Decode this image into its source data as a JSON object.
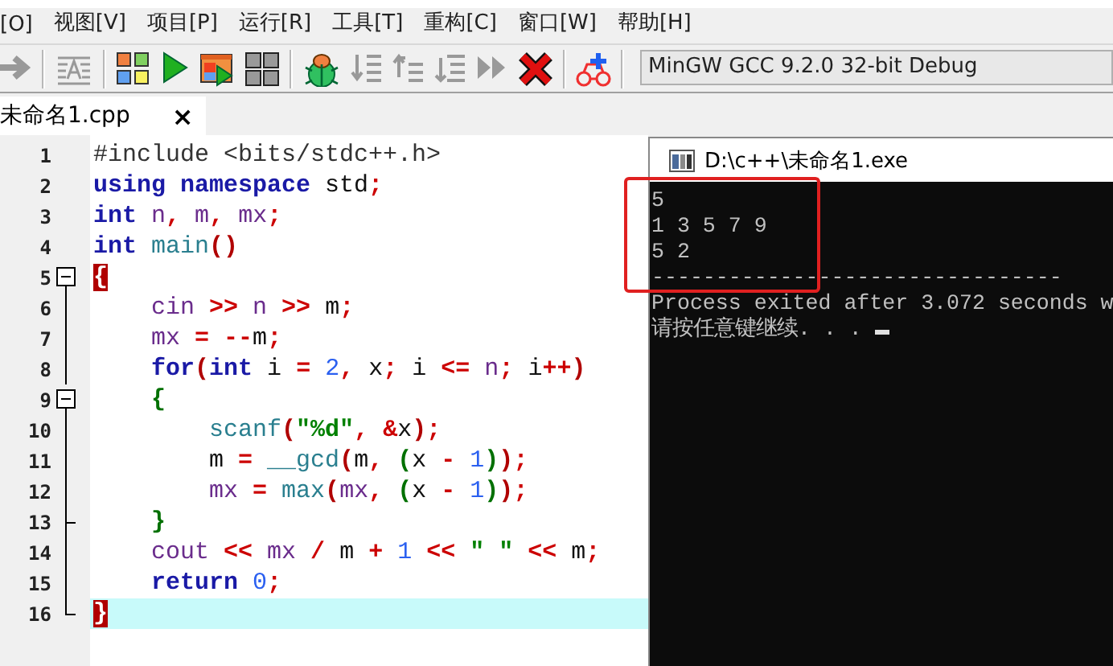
{
  "menu": [
    {
      "label": "[O]"
    },
    {
      "label": "视图[V]"
    },
    {
      "label": "项目[P]"
    },
    {
      "label": "运行[R]"
    },
    {
      "label": "工具[T]"
    },
    {
      "label": "重构[C]"
    },
    {
      "label": "窗口[W]"
    },
    {
      "label": "帮助[H]"
    }
  ],
  "toolbar": {
    "compiler": "MinGW GCC 9.2.0 32-bit Debug"
  },
  "tabs": [
    {
      "label": "未命名1.cpp",
      "close": "×",
      "selected": true
    }
  ],
  "editor": {
    "lines": [
      {
        "number": "1",
        "kind": "none",
        "current": false,
        "tokens": [
          {
            "kind": "pp",
            "t": "#include <bits/stdc++.h>"
          }
        ]
      },
      {
        "number": "2",
        "kind": "none",
        "current": false,
        "tokens": [
          {
            "kind": "kw",
            "t": "using"
          },
          {
            "kind": "kw",
            "t": " namespace"
          },
          {
            "kind": "id",
            "t": " std"
          },
          {
            "kind": "op",
            "t": ";"
          }
        ]
      },
      {
        "number": "3",
        "kind": "none",
        "current": false,
        "tokens": [
          {
            "kind": "kw",
            "t": "int"
          },
          {
            "kind": "var",
            "t": " n"
          },
          {
            "kind": "op",
            "t": ","
          },
          {
            "kind": "var",
            "t": " m"
          },
          {
            "kind": "op",
            "t": ","
          },
          {
            "kind": "var",
            "t": " mx"
          },
          {
            "kind": "op",
            "t": ";"
          }
        ]
      },
      {
        "number": "4",
        "kind": "none",
        "current": false,
        "tokens": [
          {
            "kind": "kw",
            "t": "int"
          },
          {
            "kind": "fn",
            "t": " main"
          },
          {
            "kind": "br1",
            "t": "()"
          }
        ]
      },
      {
        "number": "5",
        "kind": "start",
        "current": false,
        "tokens": [
          {
            "kind": "match",
            "t": "{"
          }
        ]
      },
      {
        "number": "6",
        "kind": "inner",
        "current": false,
        "tokens": [
          {
            "kind": "var",
            "t": "    cin"
          },
          {
            "kind": "op",
            "t": " >>"
          },
          {
            "kind": "var",
            "t": " n"
          },
          {
            "kind": "op",
            "t": " >>"
          },
          {
            "kind": "id",
            "t": " m"
          },
          {
            "kind": "op",
            "t": ";"
          }
        ]
      },
      {
        "number": "7",
        "kind": "inner",
        "current": false,
        "tokens": [
          {
            "kind": "var",
            "t": "    mx"
          },
          {
            "kind": "op",
            "t": " ="
          },
          {
            "kind": "op",
            "t": " --"
          },
          {
            "kind": "id",
            "t": "m"
          },
          {
            "kind": "op",
            "t": ";"
          }
        ]
      },
      {
        "number": "8",
        "kind": "inner",
        "current": false,
        "tokens": [
          {
            "kind": "kw",
            "t": "    for"
          },
          {
            "kind": "br1",
            "t": "("
          },
          {
            "kind": "kw",
            "t": "int"
          },
          {
            "kind": "id",
            "t": " i"
          },
          {
            "kind": "op",
            "t": " ="
          },
          {
            "kind": "num",
            "t": " 2"
          },
          {
            "kind": "op",
            "t": ","
          },
          {
            "kind": "id",
            "t": " x"
          },
          {
            "kind": "op",
            "t": ";"
          },
          {
            "kind": "id",
            "t": " i"
          },
          {
            "kind": "op",
            "t": " <="
          },
          {
            "kind": "var",
            "t": " n"
          },
          {
            "kind": "op",
            "t": ";"
          },
          {
            "kind": "id",
            "t": " i"
          },
          {
            "kind": "op",
            "t": "++"
          },
          {
            "kind": "br1",
            "t": ")"
          }
        ]
      },
      {
        "number": "9",
        "kind": "start",
        "current": false,
        "tokens": [
          {
            "kind": "br2",
            "t": "    {"
          }
        ]
      },
      {
        "number": "10",
        "kind": "inner",
        "current": false,
        "tokens": [
          {
            "kind": "fn",
            "t": "        scanf"
          },
          {
            "kind": "br1",
            "t": "("
          },
          {
            "kind": "str",
            "t": "\"%d\""
          },
          {
            "kind": "op",
            "t": ","
          },
          {
            "kind": "op",
            "t": " &"
          },
          {
            "kind": "id",
            "t": "x"
          },
          {
            "kind": "br1",
            "t": ")"
          },
          {
            "kind": "op",
            "t": ";"
          }
        ]
      },
      {
        "number": "11",
        "kind": "inner",
        "current": false,
        "tokens": [
          {
            "kind": "id",
            "t": "        m"
          },
          {
            "kind": "op",
            "t": " ="
          },
          {
            "kind": "fn",
            "t": " __gcd"
          },
          {
            "kind": "br1",
            "t": "("
          },
          {
            "kind": "id",
            "t": "m"
          },
          {
            "kind": "op",
            "t": ","
          },
          {
            "kind": "br2",
            "t": " ("
          },
          {
            "kind": "id",
            "t": "x"
          },
          {
            "kind": "op",
            "t": " -"
          },
          {
            "kind": "num",
            "t": " 1"
          },
          {
            "kind": "br2",
            "t": ")"
          },
          {
            "kind": "br1",
            "t": ")"
          },
          {
            "kind": "op",
            "t": ";"
          }
        ]
      },
      {
        "number": "12",
        "kind": "inner",
        "current": false,
        "tokens": [
          {
            "kind": "var",
            "t": "        mx"
          },
          {
            "kind": "op",
            "t": " ="
          },
          {
            "kind": "fn",
            "t": " max"
          },
          {
            "kind": "br1",
            "t": "("
          },
          {
            "kind": "var",
            "t": "mx"
          },
          {
            "kind": "op",
            "t": ","
          },
          {
            "kind": "br2",
            "t": " ("
          },
          {
            "kind": "id",
            "t": "x"
          },
          {
            "kind": "op",
            "t": " -"
          },
          {
            "kind": "num",
            "t": " 1"
          },
          {
            "kind": "br2",
            "t": ")"
          },
          {
            "kind": "br1",
            "t": ")"
          },
          {
            "kind": "op",
            "t": ";"
          }
        ]
      },
      {
        "number": "13",
        "kind": "branch_end",
        "current": false,
        "tokens": [
          {
            "kind": "br2",
            "t": "    }"
          }
        ]
      },
      {
        "number": "14",
        "kind": "inner",
        "current": false,
        "tokens": [
          {
            "kind": "var",
            "t": "    cout"
          },
          {
            "kind": "op",
            "t": " <<"
          },
          {
            "kind": "var",
            "t": " mx"
          },
          {
            "kind": "op",
            "t": " /"
          },
          {
            "kind": "id",
            "t": " m"
          },
          {
            "kind": "op",
            "t": " +"
          },
          {
            "kind": "num",
            "t": " 1"
          },
          {
            "kind": "op",
            "t": " <<"
          },
          {
            "kind": "str",
            "t": " \" \""
          },
          {
            "kind": "op",
            "t": " <<"
          },
          {
            "kind": "id",
            "t": " m"
          },
          {
            "kind": "op",
            "t": ";"
          }
        ]
      },
      {
        "number": "15",
        "kind": "inner",
        "current": false,
        "tokens": [
          {
            "kind": "kw",
            "t": "    return"
          },
          {
            "kind": "num",
            "t": " 0"
          },
          {
            "kind": "op",
            "t": ";"
          }
        ]
      },
      {
        "number": "16",
        "kind": "end",
        "current": true,
        "tokens": [
          {
            "kind": "match",
            "t": "}"
          }
        ]
      }
    ]
  },
  "console": {
    "title": "D:\\c++\\未命名1.exe",
    "lines": [
      "5",
      "1 3 5 7 9",
      "5 2",
      "--------------------------------",
      "Process exited after 3.072 seconds w"
    ],
    "prompt": "请按任意键继续. . . "
  }
}
